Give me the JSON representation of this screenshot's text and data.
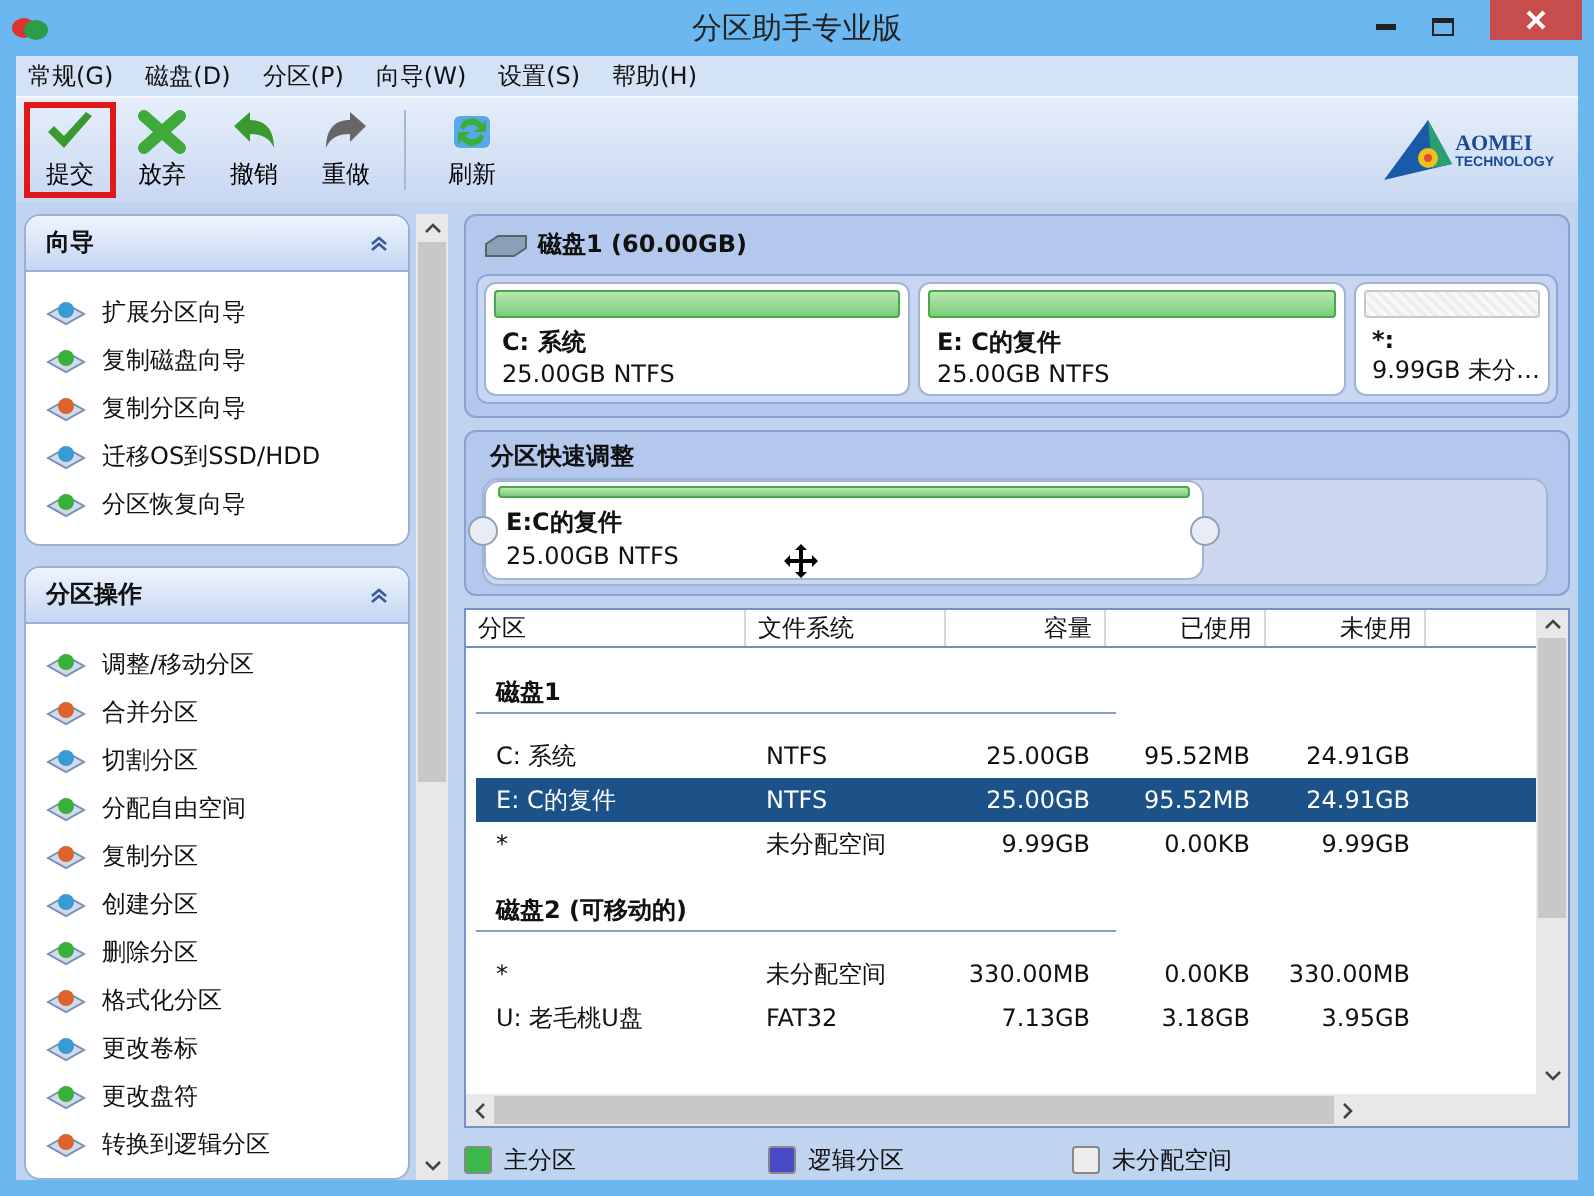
{
  "window": {
    "title": "分区助手专业版"
  },
  "menu": [
    "常规(G)",
    "磁盘(D)",
    "分区(P)",
    "向导(W)",
    "设置(S)",
    "帮助(H)"
  ],
  "toolbar": [
    {
      "label": "提交",
      "kind": "check",
      "selected": true
    },
    {
      "label": "放弃",
      "kind": "cross",
      "selected": false
    },
    {
      "label": "撤销",
      "kind": "undo",
      "selected": false
    },
    {
      "label": "重做",
      "kind": "redo",
      "selected": false
    },
    {
      "label": "刷新",
      "kind": "refresh",
      "selected": false
    }
  ],
  "logo": {
    "name": "AOMEI",
    "sub": "TECHNOLOGY"
  },
  "sidebar": [
    {
      "title": "向导",
      "items": [
        "扩展分区向导",
        "复制磁盘向导",
        "复制分区向导",
        "迁移OS到SSD/HDD",
        "分区恢复向导"
      ]
    },
    {
      "title": "分区操作",
      "items": [
        "调整/移动分区",
        "合并分区",
        "切割分区",
        "分配自由空间",
        "复制分区",
        "创建分区",
        "删除分区",
        "格式化分区",
        "更改卷标",
        "更改盘符",
        "转换到逻辑分区"
      ]
    }
  ],
  "disk_map": {
    "title": "磁盘1 (60.00GB)",
    "partitions": [
      {
        "name": "C: 系统",
        "info": "25.00GB NTFS",
        "kind": "primary"
      },
      {
        "name": "E: C的复件",
        "info": "25.00GB NTFS",
        "kind": "primary"
      },
      {
        "name": "*:",
        "info": "9.99GB 未分…",
        "kind": "unallocated"
      }
    ]
  },
  "quick_adjust": {
    "title": "分区快速调整",
    "name": "E:C的复件",
    "info": "25.00GB NTFS"
  },
  "table": {
    "columns": [
      "分区",
      "文件系统",
      "容量",
      "已使用",
      "未使用"
    ],
    "groups": [
      {
        "title": "磁盘1",
        "rows": [
          {
            "cells": [
              "C: 系统",
              "NTFS",
              "25.00GB",
              "95.52MB",
              "24.91GB"
            ],
            "selected": false
          },
          {
            "cells": [
              "E: C的复件",
              "NTFS",
              "25.00GB",
              "95.52MB",
              "24.91GB"
            ],
            "selected": true
          },
          {
            "cells": [
              "*",
              "未分配空间",
              "9.99GB",
              "0.00KB",
              "9.99GB"
            ],
            "selected": false
          }
        ]
      },
      {
        "title": "磁盘2 (可移动的)",
        "rows": [
          {
            "cells": [
              "*",
              "未分配空间",
              "330.00MB",
              "0.00KB",
              "330.00MB"
            ],
            "selected": false
          },
          {
            "cells": [
              "U: 老毛桃U盘",
              "FAT32",
              "7.13GB",
              "3.18GB",
              "3.95GB"
            ],
            "selected": false
          }
        ]
      }
    ]
  },
  "legend": [
    {
      "label": "主分区",
      "color": "#3cb84a"
    },
    {
      "label": "逻辑分区",
      "color": "#4a4ac8"
    },
    {
      "label": "未分配空间",
      "color": "#ececec"
    }
  ]
}
